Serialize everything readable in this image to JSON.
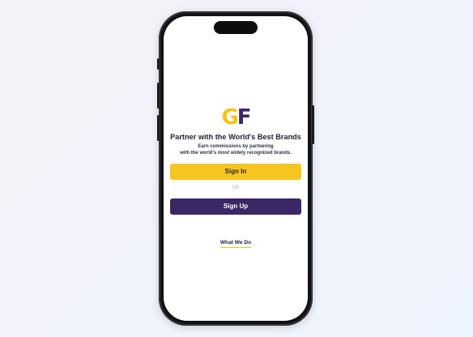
{
  "logo": {
    "letter_1": "G",
    "letter_2": "F",
    "color_1": "#f4c21a",
    "color_2": "#3d2766"
  },
  "headline": "Partner with the World's Best Brands",
  "subtext": {
    "line_1": "Earn commissions by partnering",
    "line_2": "with the world's most widely recognized brands."
  },
  "actions": {
    "sign_in_label": "Sign In",
    "or_label": "OR",
    "sign_up_label": "Sign Up",
    "what_we_do_label": "What We Do"
  },
  "colors": {
    "primary_yellow": "#f7c520",
    "primary_purple": "#3b2766"
  }
}
